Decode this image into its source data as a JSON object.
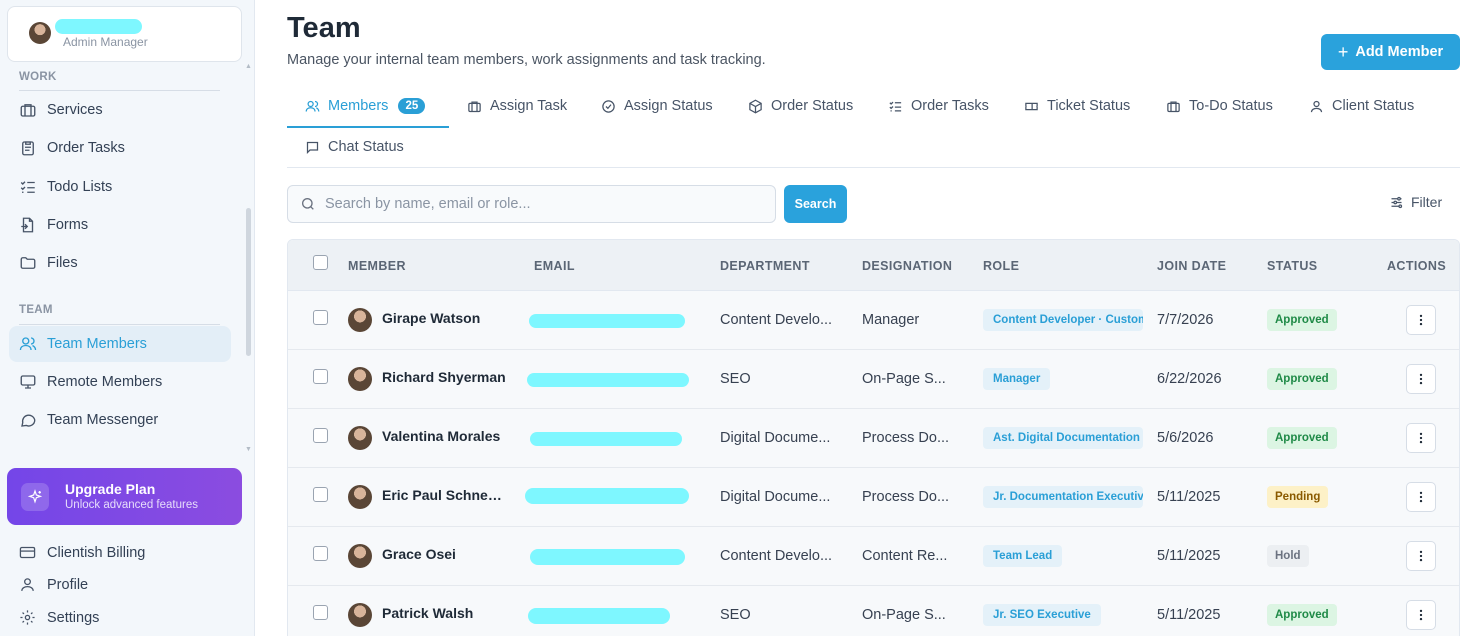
{
  "profile": {
    "role": "Admin Manager"
  },
  "sidebar": {
    "work_label": "WORK",
    "work_items": [
      {
        "label": "Services",
        "icon": "briefcase-icon"
      },
      {
        "label": "Order Tasks",
        "icon": "clipboard-icon"
      },
      {
        "label": "Todo Lists",
        "icon": "checklist-icon"
      },
      {
        "label": "Forms",
        "icon": "form-icon"
      },
      {
        "label": "Files",
        "icon": "folder-icon"
      }
    ],
    "team_label": "TEAM",
    "team_items": [
      {
        "label": "Team Members",
        "icon": "users-icon",
        "active": true
      },
      {
        "label": "Remote Members",
        "icon": "monitor-icon"
      },
      {
        "label": "Team Messenger",
        "icon": "chat-icon"
      }
    ],
    "upgrade": {
      "title": "Upgrade Plan",
      "subtitle": "Unlock advanced features"
    },
    "bottom_items": [
      {
        "label": "Clientish Billing",
        "icon": "credit-card-icon"
      },
      {
        "label": "Profile",
        "icon": "user-icon"
      },
      {
        "label": "Settings",
        "icon": "gear-icon"
      }
    ]
  },
  "header": {
    "title": "Team",
    "subtitle": "Manage your internal team members, work assignments and task tracking.",
    "add_button": "Add Member"
  },
  "tabs": [
    {
      "label": "Members",
      "badge": "25",
      "active": true
    },
    {
      "label": "Assign Task"
    },
    {
      "label": "Assign Status"
    },
    {
      "label": "Order Status"
    },
    {
      "label": "Order Tasks"
    },
    {
      "label": "Ticket Status"
    },
    {
      "label": "To-Do Status"
    },
    {
      "label": "Client Status"
    },
    {
      "label": "Chat Status"
    }
  ],
  "search": {
    "placeholder": "Search by name, email or role...",
    "button": "Search"
  },
  "filter_label": "Filter",
  "table": {
    "columns": [
      "MEMBER",
      "EMAIL",
      "DEPARTMENT",
      "DESIGNATION",
      "ROLE",
      "JOIN DATE",
      "STATUS",
      "ACTIONS"
    ],
    "rows": [
      {
        "name": "Girape Watson",
        "department": "Content Develo...",
        "designation": "Manager",
        "role": "Content Developer · Custom",
        "join_date": "7/7/2026",
        "status": "Approved"
      },
      {
        "name": "Richard Shyerman",
        "department": "SEO",
        "designation": "On-Page S...",
        "role": "Manager",
        "join_date": "6/22/2026",
        "status": "Approved"
      },
      {
        "name": "Valentina Morales",
        "department": "Digital Docume...",
        "designation": "Process Do...",
        "role": "Ast. Digital Documentation L",
        "join_date": "5/6/2026",
        "status": "Approved"
      },
      {
        "name": "Eric Paul Schnei...",
        "department": "Digital Docume...",
        "designation": "Process Do...",
        "role": "Jr. Documentation Executive",
        "join_date": "5/11/2025",
        "status": "Pending"
      },
      {
        "name": "Grace Osei",
        "department": "Content Develo...",
        "designation": "Content Re...",
        "role": "Team Lead",
        "join_date": "5/11/2025",
        "status": "Hold"
      },
      {
        "name": "Patrick Walsh",
        "department": "SEO",
        "designation": "On-Page S...",
        "role": "Jr. SEO Executive",
        "join_date": "5/11/2025",
        "status": "Approved"
      }
    ]
  },
  "colors": {
    "accent": "#2aa2dc",
    "upgrade_gradient_start": "#7446e8",
    "upgrade_gradient_end": "#8b4ce0"
  }
}
